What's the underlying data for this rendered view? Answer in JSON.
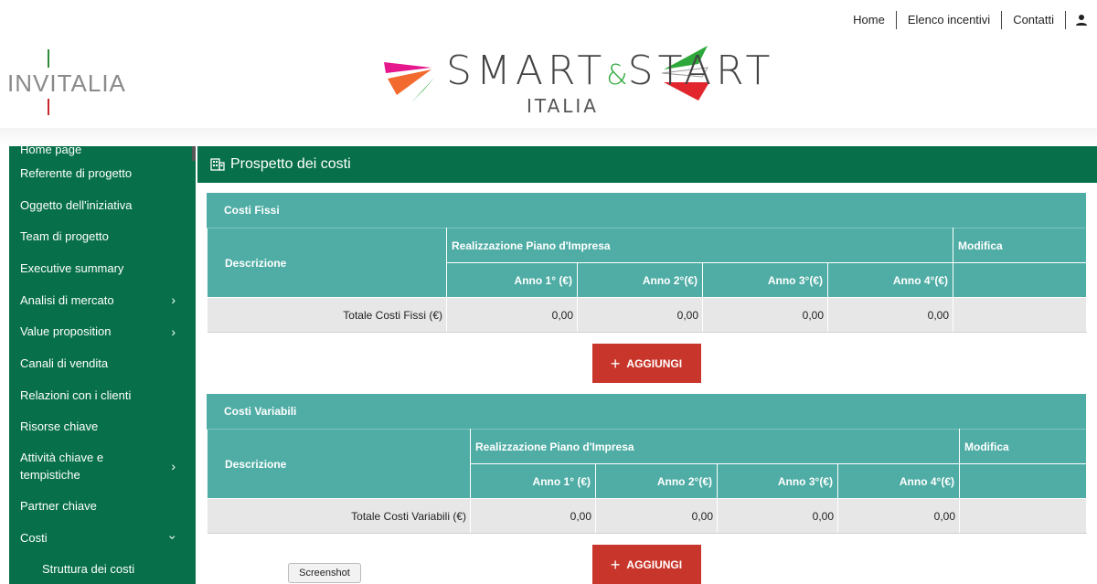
{
  "topnav": {
    "home": "Home",
    "incentivi": "Elenco incentivi",
    "contatti": "Contatti"
  },
  "brand": {
    "name": "INVITALIA"
  },
  "logo": {
    "smart": "SMART",
    "amp": "&",
    "start": "START",
    "italia": "ITALIA"
  },
  "sidebar": {
    "items": [
      {
        "label": "Home page"
      },
      {
        "label": "Referente di progetto"
      },
      {
        "label": "Oggetto dell'iniziativa"
      },
      {
        "label": "Team di progetto"
      },
      {
        "label": "Executive summary"
      },
      {
        "label": "Analisi di mercato"
      },
      {
        "label": "Value proposition"
      },
      {
        "label": "Canali di vendita"
      },
      {
        "label": "Relazioni con i clienti"
      },
      {
        "label": "Risorse chiave"
      },
      {
        "label": "Attività chiave e tempistiche"
      },
      {
        "label": "Partner chiave"
      },
      {
        "label": "Costi"
      },
      {
        "label": "Struttura dei costi"
      }
    ]
  },
  "main": {
    "title": "Prospetto dei costi",
    "fissi": {
      "title": "Costi Fissi",
      "descrizione": "Descrizione",
      "realizzazione": "Realizzazione Piano d'Impresa",
      "modifica": "Modifica",
      "years": [
        "Anno 1° (€)",
        "Anno 2°(€)",
        "Anno 3°(€)",
        "Anno 4°(€)"
      ],
      "total_label": "Totale Costi Fissi (€)",
      "totals": [
        "0,00",
        "0,00",
        "0,00",
        "0,00"
      ]
    },
    "variabili": {
      "title": "Costi Variabili",
      "descrizione": "Descrizione",
      "realizzazione": "Realizzazione Piano d'Impresa",
      "modifica": "Modifica",
      "years": [
        "Anno 1° (€)",
        "Anno 2°(€)",
        "Anno 3°(€)",
        "Anno 4°(€)"
      ],
      "total_label": "Totale Costi Variabili (€)",
      "totals": [
        "0,00",
        "0,00",
        "0,00",
        "0,00"
      ]
    },
    "add_label": "AGGIUNGI",
    "add_plus": "+"
  },
  "tooltip": {
    "text": "Screenshot"
  },
  "colors": {
    "green": "#07704a",
    "teal": "#4fada5",
    "red": "#c8362b"
  }
}
